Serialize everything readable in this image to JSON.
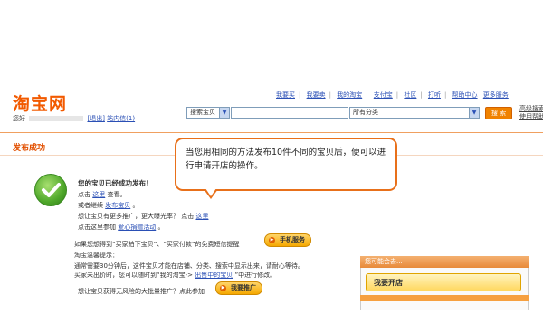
{
  "header": {
    "logo": "淘宝网",
    "greeting_prefix": "您好",
    "logout": "[退出]",
    "inbox": "站内信(1)"
  },
  "nav": {
    "items": [
      "我要买",
      "我要卖",
      "我的淘宝",
      "支付宝",
      "社区",
      "打听",
      "帮助中心",
      "更多服务"
    ]
  },
  "search": {
    "scope": "搜索宝贝",
    "query": "",
    "category": "所有分类",
    "button": "搜 索",
    "advanced": "高级搜索 使用帮助"
  },
  "page": {
    "title": "发布成功"
  },
  "success": {
    "headline": "您的宝贝已经成功发布！",
    "line1_pre": "点击",
    "line1_link": "这里",
    "line1_post": "查看。",
    "line2_pre": "或者继续",
    "line2_link": "发布宝贝",
    "line2_post": "。",
    "line3_pre": "想让宝贝有更多推广，更大曝光率？ 点击",
    "line3_link": "这里",
    "line4_pre": "点击这里参加",
    "line4_link": "爱心捐赠活动",
    "line4_post": "。",
    "sms_line1": "如果您想得到“买家拍下宝贝”、“买家付款”的免费短信提醒",
    "sms_line2": "淘宝温馨提示：",
    "sms_line3": "通常需要30分钟后，这件宝贝才能在店铺、分类、搜索中显示出来，请耐心等待。",
    "sms_line4_pre": "买家未出价时，您可以随时到“我的淘宝->",
    "sms_line4_link": "出售中的宝贝",
    "sms_line4_post": "”中进行修改。",
    "mobile_button": "手机服务",
    "promo_line": "想让宝贝获得无风险的大批量推广？点此参加",
    "promo_button": "我要推广"
  },
  "tooltip": {
    "text": "当您用相同的方法发布10件不同的宝贝后，便可以进行申请开店的操作。"
  },
  "side_panel": {
    "header": "您可能会去...",
    "button": "我要开店"
  },
  "colors": {
    "brand_orange": "#f25a00",
    "link_blue": "#2a4fb5",
    "tooltip_border": "#e8701a"
  }
}
